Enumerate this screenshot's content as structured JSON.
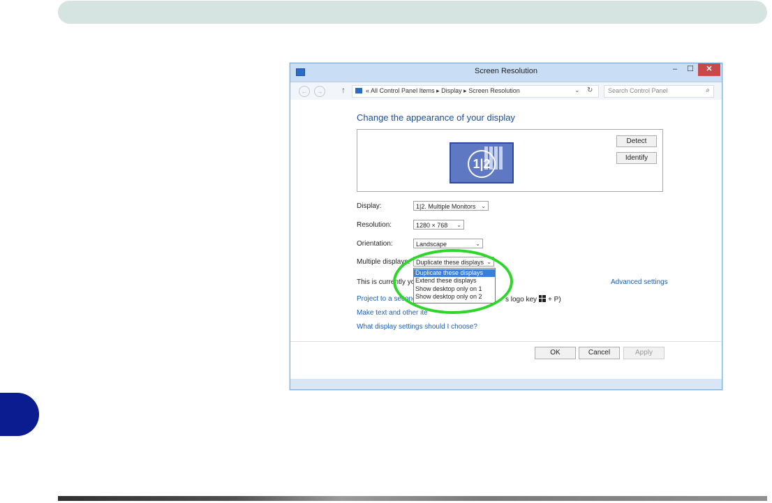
{
  "window": {
    "title": "Screen Resolution",
    "controls": {
      "minimize": "–",
      "maximize": "☐",
      "close": "✕"
    }
  },
  "navigation": {
    "back": "←",
    "forward": "→",
    "up": "↑",
    "address_prefix": "«",
    "breadcrumb": [
      "All Control Panel Items",
      "Display",
      "Screen Resolution"
    ],
    "dropdown": "⌄",
    "refresh": "↻",
    "search_placeholder": "Search Control Panel",
    "search_icon": "⌕"
  },
  "main": {
    "heading": "Change the appearance of your display",
    "monitor_label": "1|2",
    "detect_button": "Detect",
    "identify_button": "Identify",
    "fields": {
      "display_label": "Display:",
      "display_value": "1|2. Multiple Monitors",
      "resolution_label": "Resolution:",
      "resolution_value": "1280 × 768",
      "orientation_label": "Orientation:",
      "orientation_value": "Landscape",
      "multiple_displays_label": "Multiple displays:",
      "multiple_displays_value": "Duplicate these displays"
    },
    "multiple_displays_options": [
      "Duplicate these displays",
      "Extend these displays",
      "Show desktop only on 1",
      "Show desktop only on 2"
    ],
    "current_text": "This is currently you",
    "advanced_link": "Advanced settings",
    "project_link": "Project to a second",
    "project_tail_text": "s logo key",
    "project_tail_suffix": "+ P)",
    "make_text_link": "Make text and other ite",
    "choose_link": "What display settings should I choose?"
  },
  "footer": {
    "ok": "OK",
    "cancel": "Cancel",
    "apply": "Apply"
  },
  "colors": {
    "top_bar": "#d5e4e0",
    "side_tab": "#0a1c8f",
    "highlight": "#2ed62a",
    "link": "#1a5fb4",
    "selected_option": "#3b7ed6"
  }
}
